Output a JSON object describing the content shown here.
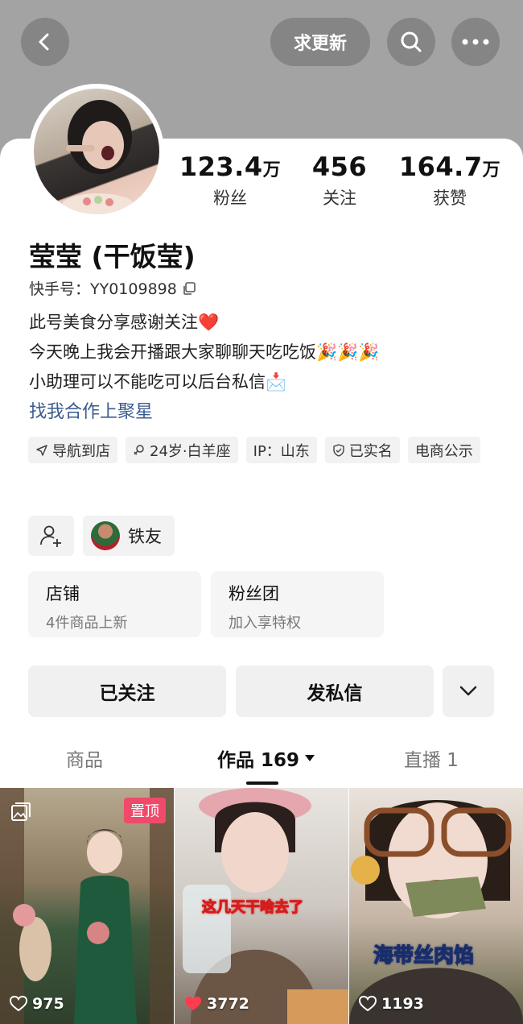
{
  "top_bar": {
    "update_label": "求更新"
  },
  "stats": [
    {
      "num": "123.4",
      "unit": "万",
      "label": "粉丝"
    },
    {
      "num": "456",
      "unit": "",
      "label": "关注"
    },
    {
      "num": "164.7",
      "unit": "万",
      "label": "获赞"
    }
  ],
  "profile": {
    "name": "莹莹 (干饭莹)",
    "kuaishou_id": "快手号：YY0109898",
    "bio_lines": [
      "此号美食分享感谢关注❤️",
      "今天晚上我会开播跟大家聊聊天吃吃饭🎉🎉🎉",
      "小助理可以不能吃可以后台私信📩"
    ],
    "coop_link": "找我合作上聚星"
  },
  "tags": [
    {
      "label": "导航到店",
      "icon": "navigation-icon"
    },
    {
      "label": "24岁·白羊座",
      "icon": "female-icon"
    },
    {
      "label": "IP：山东",
      "icon": ""
    },
    {
      "label": "已实名",
      "icon": "verified-shield-icon"
    },
    {
      "label": "电商公示",
      "icon": ""
    }
  ],
  "friend": {
    "label": "铁友"
  },
  "features": [
    {
      "title": "店铺",
      "subtitle": "4件商品上新"
    },
    {
      "title": "粉丝团",
      "subtitle": "加入享特权"
    }
  ],
  "actions": {
    "follow_label": "已关注",
    "message_label": "发私信"
  },
  "tabs": [
    {
      "label": "商品"
    },
    {
      "label": "作品 169"
    },
    {
      "label": "直播 1"
    }
  ],
  "videos": [
    {
      "likes": "975",
      "badge": "置顶",
      "overlay": ""
    },
    {
      "likes": "3772",
      "badge": "",
      "overlay": "这几天干啥去了"
    },
    {
      "likes": "1193",
      "badge": "",
      "overlay": "海带丝肉馅"
    }
  ],
  "colors": {
    "header_bg": "#a3a3a3",
    "link": "#3b5b8f",
    "pin_badge": "#f04a6a",
    "like_red": "#ff3b4e"
  }
}
